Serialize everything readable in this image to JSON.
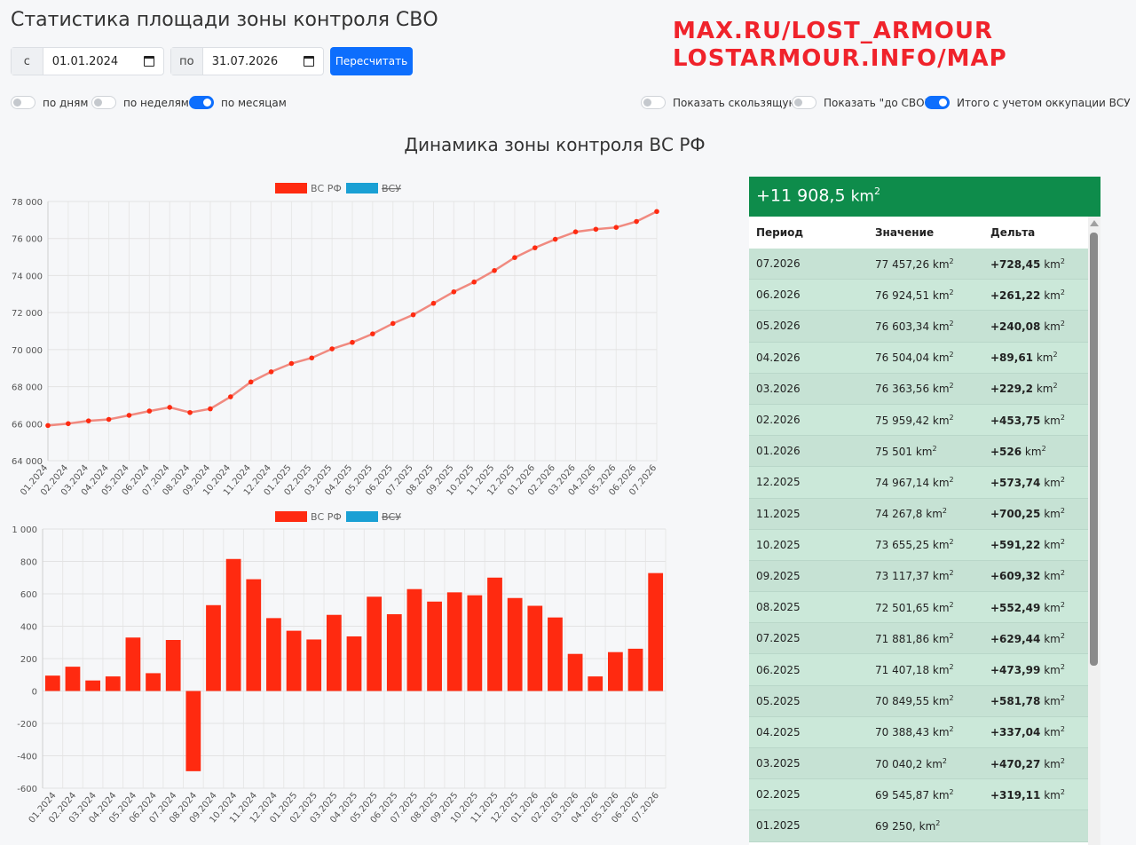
{
  "header": {
    "title": "Статистика площади зоны контроля СВО",
    "brand_line1": "MAX.RU/LOST_ARMOUR",
    "brand_line2": "LOSTARMOUR.INFO/MAP"
  },
  "filters": {
    "from_label": "с",
    "from_value": "01.01.2024",
    "to_label": "по",
    "to_value": "31.07.2026",
    "recalc_label": "Пересчитать"
  },
  "toggles": [
    {
      "label": "по дням",
      "on": false
    },
    {
      "label": "по неделям",
      "on": false
    },
    {
      "label": "по месяцам",
      "on": true
    },
    {
      "label": "Показать скользящую",
      "on": false
    },
    {
      "label": "Показать \"до СВО\"",
      "on": false
    },
    {
      "label": "Итого с учетом оккупации ВСУ",
      "on": true
    }
  ],
  "chart_heading": "Динамика зоны контроля ВС РФ",
  "colors": {
    "rf": "#ff2a10",
    "rf_line": "#f08a80",
    "vsu": "#1aa0d4",
    "panel": "#0e8c4b",
    "accent": "#0d6efd"
  },
  "chart_data": [
    {
      "type": "line",
      "legend": [
        {
          "name": "ВС РФ",
          "color": "#ff2a10",
          "hidden": false
        },
        {
          "name": "ВСУ",
          "color": "#1aa0d4",
          "hidden": true
        }
      ],
      "legend_position": "top",
      "grid": true,
      "ylim": [
        64000,
        78000
      ],
      "yticks": [
        64000,
        66000,
        68000,
        70000,
        72000,
        74000,
        76000,
        78000
      ],
      "ytick_labels": [
        "64 000",
        "66 000",
        "68 000",
        "70 000",
        "72 000",
        "74 000",
        "76 000",
        "78 000"
      ],
      "categories": [
        "01.2024",
        "02.2024",
        "03.2024",
        "04.2024",
        "05.2024",
        "06.2024",
        "07.2024",
        "08.2024",
        "09.2024",
        "10.2024",
        "11.2024",
        "12.2024",
        "01.2025",
        "02.2025",
        "03.2025",
        "04.2025",
        "05.2025",
        "06.2025",
        "07.2025",
        "08.2025",
        "09.2025",
        "10.2025",
        "11.2025",
        "12.2025",
        "01.2026",
        "02.2026",
        "03.2026",
        "04.2026",
        "05.2026",
        "06.2026",
        "07.2026"
      ],
      "series": [
        {
          "name": "ВС РФ",
          "values": [
            65900,
            66000,
            66150,
            66230,
            66450,
            66680,
            66880,
            66600,
            66800,
            67450,
            68250,
            68800,
            69250,
            69550,
            70040,
            70390,
            70850,
            71410,
            71880,
            72500,
            73120,
            73650,
            74270,
            74970,
            75500,
            75960,
            76360,
            76500,
            76600,
            76920,
            77460
          ]
        }
      ]
    },
    {
      "type": "bar",
      "legend": [
        {
          "name": "ВС РФ",
          "color": "#ff2a10",
          "hidden": false
        },
        {
          "name": "ВСУ",
          "color": "#1aa0d4",
          "hidden": true
        }
      ],
      "legend_position": "top",
      "grid": true,
      "ylim": [
        -600,
        1000
      ],
      "yticks": [
        -600,
        -400,
        -200,
        0,
        200,
        400,
        600,
        800,
        1000
      ],
      "ytick_labels": [
        "-600",
        "-400",
        "-200",
        "0",
        "200",
        "400",
        "600",
        "800",
        "1 000"
      ],
      "categories": [
        "01.2024",
        "02.2024",
        "03.2024",
        "04.2024",
        "05.2024",
        "06.2024",
        "07.2024",
        "08.2024",
        "09.2024",
        "10.2024",
        "11.2024",
        "12.2024",
        "01.2025",
        "02.2025",
        "03.2025",
        "04.2025",
        "05.2025",
        "06.2025",
        "07.2025",
        "08.2025",
        "09.2025",
        "10.2025",
        "11.2025",
        "12.2025",
        "01.2026",
        "02.2026",
        "03.2026",
        "04.2026",
        "05.2026",
        "06.2026",
        "07.2026"
      ],
      "series": [
        {
          "name": "ВС РФ",
          "values": [
            95,
            150,
            65,
            90,
            330,
            110,
            315,
            -495,
            530,
            815,
            690,
            450,
            372,
            318,
            470,
            337,
            582,
            474,
            629,
            552,
            609,
            591,
            700,
            574,
            526,
            454,
            229,
            90,
            240,
            261,
            728
          ]
        }
      ]
    }
  ],
  "panel": {
    "total_value": "+11 908,5",
    "total_unit": "km",
    "total_power": "2",
    "headers": [
      "Период",
      "Значение",
      "Дельта"
    ],
    "unit": "km",
    "power": "2",
    "rows": [
      {
        "period": "07.2026",
        "value": "77 457,26",
        "delta": "+728,45"
      },
      {
        "period": "06.2026",
        "value": "76 924,51",
        "delta": "+261,22"
      },
      {
        "period": "05.2026",
        "value": "76 603,34",
        "delta": "+240,08"
      },
      {
        "period": "04.2026",
        "value": "76 504,04",
        "delta": "+89,61"
      },
      {
        "period": "03.2026",
        "value": "76 363,56",
        "delta": "+229,2"
      },
      {
        "period": "02.2026",
        "value": "75 959,42",
        "delta": "+453,75"
      },
      {
        "period": "01.2026",
        "value": "75 501",
        "delta": "+526"
      },
      {
        "period": "12.2025",
        "value": "74 967,14",
        "delta": "+573,74"
      },
      {
        "period": "11.2025",
        "value": "74 267,8",
        "delta": "+700,25"
      },
      {
        "period": "10.2025",
        "value": "73 655,25",
        "delta": "+591,22"
      },
      {
        "period": "09.2025",
        "value": "73 117,37",
        "delta": "+609,32"
      },
      {
        "period": "08.2025",
        "value": "72 501,65",
        "delta": "+552,49"
      },
      {
        "period": "07.2025",
        "value": "71 881,86",
        "delta": "+629,44"
      },
      {
        "period": "06.2025",
        "value": "71 407,18",
        "delta": "+473,99"
      },
      {
        "period": "05.2025",
        "value": "70 849,55",
        "delta": "+581,78"
      },
      {
        "period": "04.2025",
        "value": "70 388,43",
        "delta": "+337,04"
      },
      {
        "period": "03.2025",
        "value": "70 040,2",
        "delta": "+470,27"
      },
      {
        "period": "02.2025",
        "value": "69 545,87",
        "delta": "+319,11"
      },
      {
        "period": "01.2025",
        "value": "69 250,",
        "delta": ""
      }
    ]
  }
}
